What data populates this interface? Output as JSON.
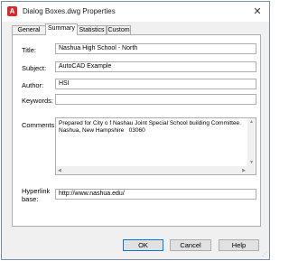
{
  "window": {
    "title": "Dialog Boxes.dwg Properties",
    "app_icon": "A",
    "close_glyph": "✕"
  },
  "tabs": [
    {
      "label": "General"
    },
    {
      "label": "Summary"
    },
    {
      "label": "Statistics"
    },
    {
      "label": "Custom"
    }
  ],
  "form": {
    "title_label": "Title:",
    "title_value": "Nashua High School - North",
    "subject_label": "Subject:",
    "subject_value": "AutoCAD Example",
    "author_label": "Author:",
    "author_value": "HSI",
    "keywords_label": "Keywords:",
    "keywords_value": "",
    "comments_label": "Comments:",
    "comments_value": "Prepared for City o f Nashau Joint Special School building Committee.\nNashua, New Hampshire   03060",
    "hyperlink_label_1": "Hyperlink",
    "hyperlink_label_2": "base:",
    "hyperlink_value": "http://www.nashua.edu/"
  },
  "buttons": {
    "ok": "OK",
    "cancel": "Cancel",
    "help": "Help"
  },
  "icons": {
    "app": "autocad-icon",
    "close": "close-icon",
    "resize": "resize-grip-icon"
  },
  "colors": {
    "app_icon": "#d32c2c",
    "default_button_border": "#0078d7"
  }
}
